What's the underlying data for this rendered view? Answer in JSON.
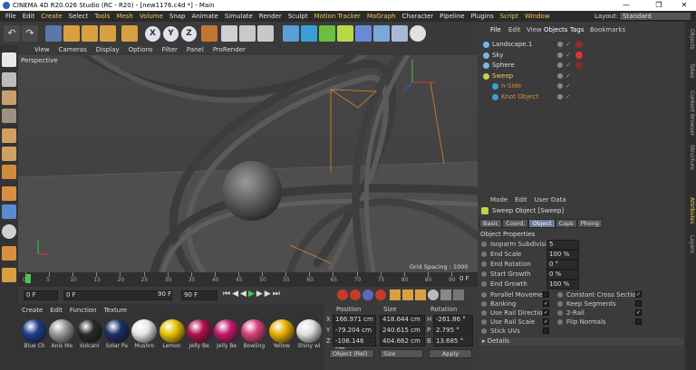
{
  "window": {
    "title": "CINEMA 4D R20.026 Studio (RC - R20) - [new1176.c4d *] - Main"
  },
  "menubar": [
    "File",
    "Edit",
    "Create",
    "Select",
    "Tools",
    "Mesh",
    "Volume",
    "Snap",
    "Animate",
    "Simulate",
    "Render",
    "Sculpt",
    "Motion Tracker",
    "MoGraph",
    "Character",
    "Pipeline",
    "Plugins",
    "Script",
    "Window"
  ],
  "layout": {
    "label": "Layout:",
    "value": "Standard"
  },
  "viewport": {
    "menu": [
      "View",
      "Cameras",
      "Display",
      "Options",
      "Filter",
      "Panel",
      "ProRender"
    ],
    "label": "Perspective",
    "grid": "Grid Spacing : 1000 cm"
  },
  "timeline": {
    "ticks": [
      "0",
      "5",
      "10",
      "15",
      "20",
      "25",
      "30",
      "35",
      "40",
      "45",
      "50",
      "55",
      "60",
      "65",
      "70",
      "75",
      "80",
      "85",
      "90"
    ],
    "frame": "0 F"
  },
  "transport": {
    "start": "0 F",
    "cur": "0 F",
    "end": "90 F",
    "end2": "90 F"
  },
  "objects": {
    "tabs": [
      "File",
      "Edit",
      "View",
      "Objects",
      "Tags",
      "Bookmarks"
    ],
    "items": [
      {
        "name": "Landscape.1"
      },
      {
        "name": "Sky"
      },
      {
        "name": "Sphere"
      },
      {
        "name": "Sweep"
      },
      {
        "name": "n-Side"
      },
      {
        "name": "Knot Object"
      }
    ]
  },
  "side_tabs": [
    "Objects",
    "Takes",
    "Content Browser",
    "Structure",
    "Attributes",
    "Layers"
  ],
  "attributes": {
    "menu": [
      "Mode",
      "Edit",
      "User Data"
    ],
    "object_title": "Sweep Object [Sweep]",
    "tabs": [
      "Basic",
      "Coord.",
      "Object",
      "Caps",
      "Phong"
    ],
    "section": "Object Properties",
    "props": [
      {
        "label": "Isoparm Subdivision",
        "value": "5"
      },
      {
        "label": "End Scale",
        "value": "100 %"
      },
      {
        "label": "End Rotation",
        "value": "0 °"
      },
      {
        "label": "Start Growth",
        "value": "0 %"
      },
      {
        "label": "End Growth",
        "value": "100 %"
      }
    ],
    "checks_left": [
      "Parallel Movement",
      "Banking",
      "Use Rail Direction",
      "Use Rail Scale",
      "Stick UVs"
    ],
    "checks_right": [
      "Constant Cross Section",
      "Keep Segments",
      "2-Rail",
      "Flip Normals"
    ],
    "details": "Details"
  },
  "materials": {
    "menu": [
      "Create",
      "Edit",
      "Function",
      "Texture"
    ],
    "items": [
      {
        "name": "Blue Ch",
        "color": "#1e3c8a"
      },
      {
        "name": "Anis Me",
        "color": "#9a9a9a"
      },
      {
        "name": "Vulcani",
        "color": "#2a2a2a"
      },
      {
        "name": "Solar Pa",
        "color": "#1a2f66"
      },
      {
        "name": "Mushro",
        "color": "#e8e8e8"
      },
      {
        "name": "Lemon",
        "color": "#e8c400"
      },
      {
        "name": "Jelly Be",
        "color": "#b0104a"
      },
      {
        "name": "Jelly Be",
        "color": "#c21a6a"
      },
      {
        "name": "Bowling",
        "color": "#d8407a"
      },
      {
        "name": "Yellow",
        "color": "#e8b000"
      },
      {
        "name": "Shiny wl",
        "color": "#e0e0e0"
      }
    ]
  },
  "coords": {
    "headers": [
      "Position",
      "Size",
      "Rotation"
    ],
    "rows": [
      {
        "a": "X",
        "p": "166.971 cm",
        "s": "418.644 cm",
        "r": "H",
        "rv": "-261.86 °"
      },
      {
        "a": "Y",
        "p": "-79.204 cm",
        "s": "240.615 cm",
        "r": "P",
        "rv": "2.795 °"
      },
      {
        "a": "Z",
        "p": "-106.146 cm",
        "s": "404.662 cm",
        "r": "B",
        "rv": "13.685 °"
      }
    ],
    "mode": "Object (Rel)",
    "size_mode": "Size",
    "apply": "Apply"
  }
}
